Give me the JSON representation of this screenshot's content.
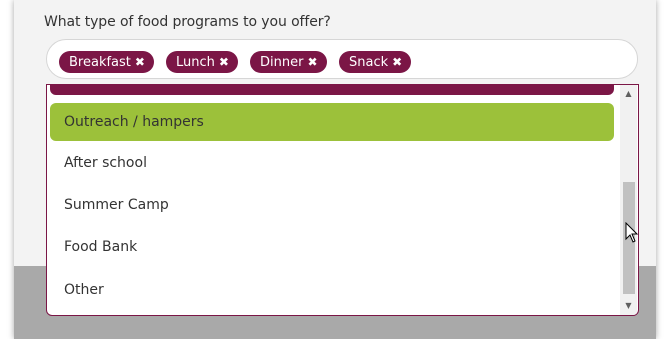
{
  "form": {
    "question": "What type of food programs to you offer?"
  },
  "selected_tags": [
    {
      "label": "Breakfast",
      "remove_icon": "✖"
    },
    {
      "label": "Lunch",
      "remove_icon": "✖"
    },
    {
      "label": "Dinner",
      "remove_icon": "✖"
    },
    {
      "label": "Snack",
      "remove_icon": "✖"
    }
  ],
  "dropdown": {
    "options": [
      {
        "label": "Outreach / hampers",
        "highlighted": true
      },
      {
        "label": "After school",
        "highlighted": false
      },
      {
        "label": "Summer Camp",
        "highlighted": false
      },
      {
        "label": "Food Bank",
        "highlighted": false
      },
      {
        "label": "Other",
        "highlighted": false
      }
    ],
    "scroll_up_icon": "▲",
    "scroll_down_icon": "▼"
  },
  "colors": {
    "tag_bg": "#7b1646",
    "highlight_bg": "#9cc13a",
    "footer_band": "#a9a9a9"
  }
}
